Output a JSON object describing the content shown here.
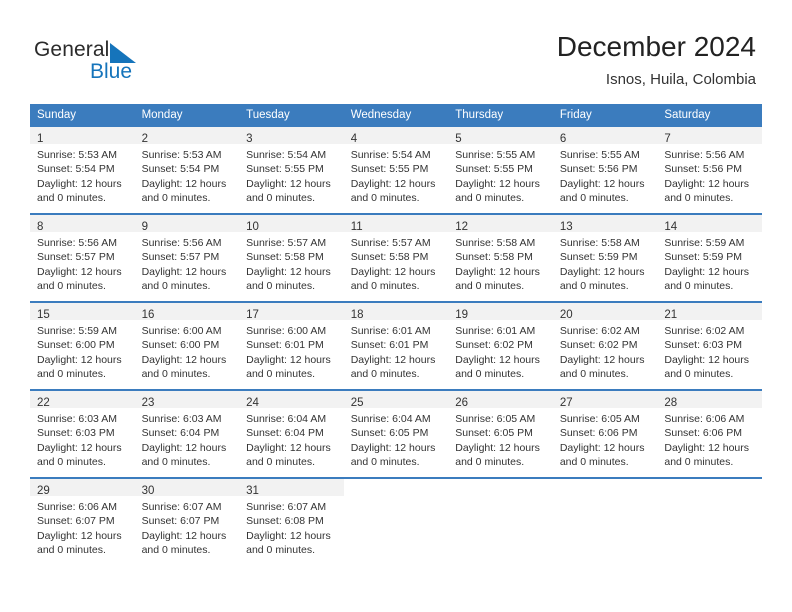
{
  "logo": {
    "primary_text": "General",
    "secondary_text": "Blue",
    "blue": "#1574bb"
  },
  "header": {
    "title": "December 2024",
    "subtitle": "Isnos, Huila, Colombia"
  },
  "theme": {
    "header_blue": "#3b7cbe",
    "daynum_band": "#f2f2f2",
    "text": "#333333"
  },
  "calendar": {
    "weekday_headers": [
      "Sunday",
      "Monday",
      "Tuesday",
      "Wednesday",
      "Thursday",
      "Friday",
      "Saturday"
    ],
    "weeks": [
      [
        {
          "day": "1",
          "sunrise": "Sunrise: 5:53 AM",
          "sunset": "Sunset: 5:54 PM",
          "daylight1": "Daylight: 12 hours",
          "daylight2": "and 0 minutes."
        },
        {
          "day": "2",
          "sunrise": "Sunrise: 5:53 AM",
          "sunset": "Sunset: 5:54 PM",
          "daylight1": "Daylight: 12 hours",
          "daylight2": "and 0 minutes."
        },
        {
          "day": "3",
          "sunrise": "Sunrise: 5:54 AM",
          "sunset": "Sunset: 5:55 PM",
          "daylight1": "Daylight: 12 hours",
          "daylight2": "and 0 minutes."
        },
        {
          "day": "4",
          "sunrise": "Sunrise: 5:54 AM",
          "sunset": "Sunset: 5:55 PM",
          "daylight1": "Daylight: 12 hours",
          "daylight2": "and 0 minutes."
        },
        {
          "day": "5",
          "sunrise": "Sunrise: 5:55 AM",
          "sunset": "Sunset: 5:55 PM",
          "daylight1": "Daylight: 12 hours",
          "daylight2": "and 0 minutes."
        },
        {
          "day": "6",
          "sunrise": "Sunrise: 5:55 AM",
          "sunset": "Sunset: 5:56 PM",
          "daylight1": "Daylight: 12 hours",
          "daylight2": "and 0 minutes."
        },
        {
          "day": "7",
          "sunrise": "Sunrise: 5:56 AM",
          "sunset": "Sunset: 5:56 PM",
          "daylight1": "Daylight: 12 hours",
          "daylight2": "and 0 minutes."
        }
      ],
      [
        {
          "day": "8",
          "sunrise": "Sunrise: 5:56 AM",
          "sunset": "Sunset: 5:57 PM",
          "daylight1": "Daylight: 12 hours",
          "daylight2": "and 0 minutes."
        },
        {
          "day": "9",
          "sunrise": "Sunrise: 5:56 AM",
          "sunset": "Sunset: 5:57 PM",
          "daylight1": "Daylight: 12 hours",
          "daylight2": "and 0 minutes."
        },
        {
          "day": "10",
          "sunrise": "Sunrise: 5:57 AM",
          "sunset": "Sunset: 5:58 PM",
          "daylight1": "Daylight: 12 hours",
          "daylight2": "and 0 minutes."
        },
        {
          "day": "11",
          "sunrise": "Sunrise: 5:57 AM",
          "sunset": "Sunset: 5:58 PM",
          "daylight1": "Daylight: 12 hours",
          "daylight2": "and 0 minutes."
        },
        {
          "day": "12",
          "sunrise": "Sunrise: 5:58 AM",
          "sunset": "Sunset: 5:58 PM",
          "daylight1": "Daylight: 12 hours",
          "daylight2": "and 0 minutes."
        },
        {
          "day": "13",
          "sunrise": "Sunrise: 5:58 AM",
          "sunset": "Sunset: 5:59 PM",
          "daylight1": "Daylight: 12 hours",
          "daylight2": "and 0 minutes."
        },
        {
          "day": "14",
          "sunrise": "Sunrise: 5:59 AM",
          "sunset": "Sunset: 5:59 PM",
          "daylight1": "Daylight: 12 hours",
          "daylight2": "and 0 minutes."
        }
      ],
      [
        {
          "day": "15",
          "sunrise": "Sunrise: 5:59 AM",
          "sunset": "Sunset: 6:00 PM",
          "daylight1": "Daylight: 12 hours",
          "daylight2": "and 0 minutes."
        },
        {
          "day": "16",
          "sunrise": "Sunrise: 6:00 AM",
          "sunset": "Sunset: 6:00 PM",
          "daylight1": "Daylight: 12 hours",
          "daylight2": "and 0 minutes."
        },
        {
          "day": "17",
          "sunrise": "Sunrise: 6:00 AM",
          "sunset": "Sunset: 6:01 PM",
          "daylight1": "Daylight: 12 hours",
          "daylight2": "and 0 minutes."
        },
        {
          "day": "18",
          "sunrise": "Sunrise: 6:01 AM",
          "sunset": "Sunset: 6:01 PM",
          "daylight1": "Daylight: 12 hours",
          "daylight2": "and 0 minutes."
        },
        {
          "day": "19",
          "sunrise": "Sunrise: 6:01 AM",
          "sunset": "Sunset: 6:02 PM",
          "daylight1": "Daylight: 12 hours",
          "daylight2": "and 0 minutes."
        },
        {
          "day": "20",
          "sunrise": "Sunrise: 6:02 AM",
          "sunset": "Sunset: 6:02 PM",
          "daylight1": "Daylight: 12 hours",
          "daylight2": "and 0 minutes."
        },
        {
          "day": "21",
          "sunrise": "Sunrise: 6:02 AM",
          "sunset": "Sunset: 6:03 PM",
          "daylight1": "Daylight: 12 hours",
          "daylight2": "and 0 minutes."
        }
      ],
      [
        {
          "day": "22",
          "sunrise": "Sunrise: 6:03 AM",
          "sunset": "Sunset: 6:03 PM",
          "daylight1": "Daylight: 12 hours",
          "daylight2": "and 0 minutes."
        },
        {
          "day": "23",
          "sunrise": "Sunrise: 6:03 AM",
          "sunset": "Sunset: 6:04 PM",
          "daylight1": "Daylight: 12 hours",
          "daylight2": "and 0 minutes."
        },
        {
          "day": "24",
          "sunrise": "Sunrise: 6:04 AM",
          "sunset": "Sunset: 6:04 PM",
          "daylight1": "Daylight: 12 hours",
          "daylight2": "and 0 minutes."
        },
        {
          "day": "25",
          "sunrise": "Sunrise: 6:04 AM",
          "sunset": "Sunset: 6:05 PM",
          "daylight1": "Daylight: 12 hours",
          "daylight2": "and 0 minutes."
        },
        {
          "day": "26",
          "sunrise": "Sunrise: 6:05 AM",
          "sunset": "Sunset: 6:05 PM",
          "daylight1": "Daylight: 12 hours",
          "daylight2": "and 0 minutes."
        },
        {
          "day": "27",
          "sunrise": "Sunrise: 6:05 AM",
          "sunset": "Sunset: 6:06 PM",
          "daylight1": "Daylight: 12 hours",
          "daylight2": "and 0 minutes."
        },
        {
          "day": "28",
          "sunrise": "Sunrise: 6:06 AM",
          "sunset": "Sunset: 6:06 PM",
          "daylight1": "Daylight: 12 hours",
          "daylight2": "and 0 minutes."
        }
      ],
      [
        {
          "day": "29",
          "sunrise": "Sunrise: 6:06 AM",
          "sunset": "Sunset: 6:07 PM",
          "daylight1": "Daylight: 12 hours",
          "daylight2": "and 0 minutes."
        },
        {
          "day": "30",
          "sunrise": "Sunrise: 6:07 AM",
          "sunset": "Sunset: 6:07 PM",
          "daylight1": "Daylight: 12 hours",
          "daylight2": "and 0 minutes."
        },
        {
          "day": "31",
          "sunrise": "Sunrise: 6:07 AM",
          "sunset": "Sunset: 6:08 PM",
          "daylight1": "Daylight: 12 hours",
          "daylight2": "and 0 minutes."
        },
        {
          "day": "",
          "sunrise": "",
          "sunset": "",
          "daylight1": "",
          "daylight2": ""
        },
        {
          "day": "",
          "sunrise": "",
          "sunset": "",
          "daylight1": "",
          "daylight2": ""
        },
        {
          "day": "",
          "sunrise": "",
          "sunset": "",
          "daylight1": "",
          "daylight2": ""
        },
        {
          "day": "",
          "sunrise": "",
          "sunset": "",
          "daylight1": "",
          "daylight2": ""
        }
      ]
    ]
  }
}
